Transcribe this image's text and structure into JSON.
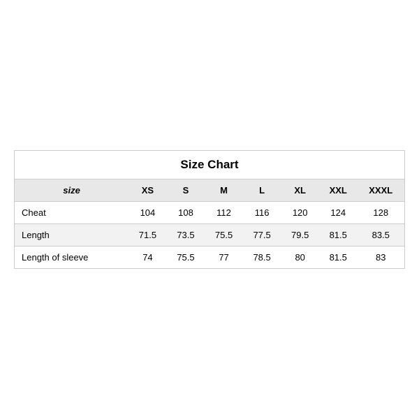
{
  "table": {
    "title": "Size Chart",
    "headers": [
      "size",
      "XS",
      "S",
      "M",
      "L",
      "XL",
      "XXL",
      "XXXL"
    ],
    "rows": [
      {
        "label": "Cheat",
        "values": [
          "104",
          "108",
          "112",
          "116",
          "120",
          "124",
          "128"
        ],
        "striped": false
      },
      {
        "label": "Length",
        "values": [
          "71.5",
          "73.5",
          "75.5",
          "77.5",
          "79.5",
          "81.5",
          "83.5"
        ],
        "striped": true
      },
      {
        "label": "Length of sleeve",
        "values": [
          "74",
          "75.5",
          "77",
          "78.5",
          "80",
          "81.5",
          "83"
        ],
        "striped": false
      }
    ]
  }
}
